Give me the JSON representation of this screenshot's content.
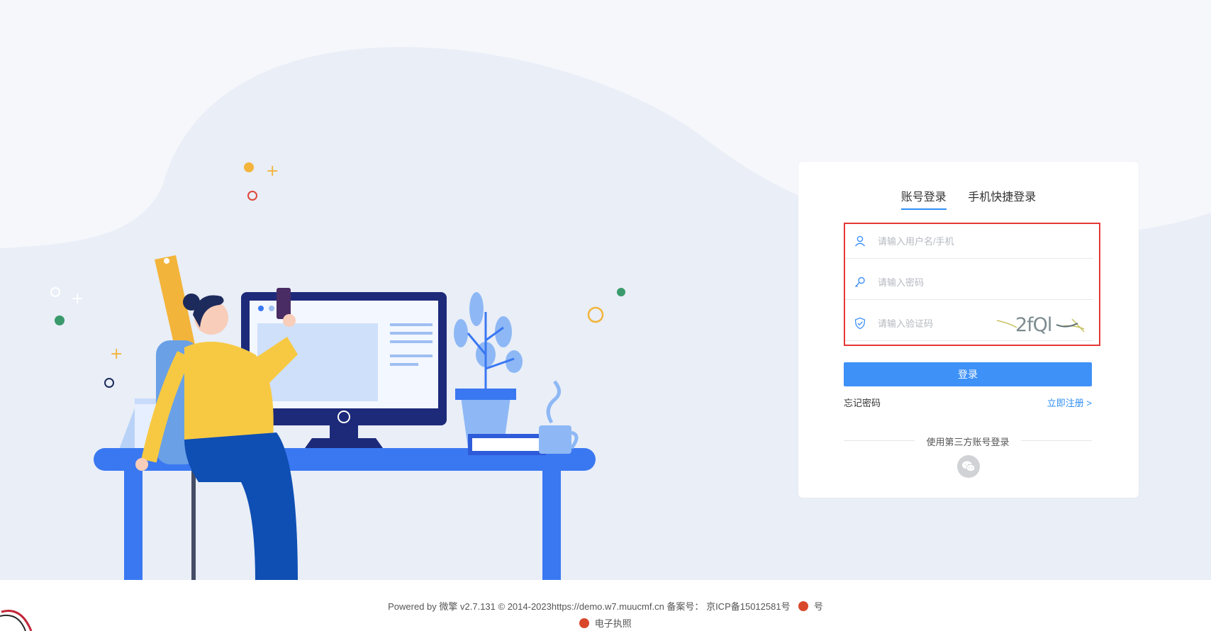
{
  "tabs": [
    {
      "label": "账号登录",
      "active": true
    },
    {
      "label": "手机快捷登录",
      "active": false
    }
  ],
  "form": {
    "username_placeholder": "请输入用户名/手机",
    "password_placeholder": "请输入密码",
    "captcha_placeholder": "请输入验证码",
    "captcha_text": "2fQl"
  },
  "login_button": "登录",
  "forgot_password": "忘记密码",
  "register": "立即注册 >",
  "third_party_label": "使用第三方账号登录",
  "footer": {
    "powered": "Powered by 微擎 v2.7.131 © 2014-2023https://demo.w7.muucmf.cn 备案号：",
    "icp": "京ICP备15012581号",
    "police": "号",
    "license": "电子执照"
  },
  "colors": {
    "accent": "#3e91f7",
    "highlight": "#e53935",
    "background": "#f5f7fb"
  },
  "icons": [
    "user-icon",
    "key-icon",
    "shield-icon",
    "wechat-icon",
    "police-emblem-icon"
  ]
}
